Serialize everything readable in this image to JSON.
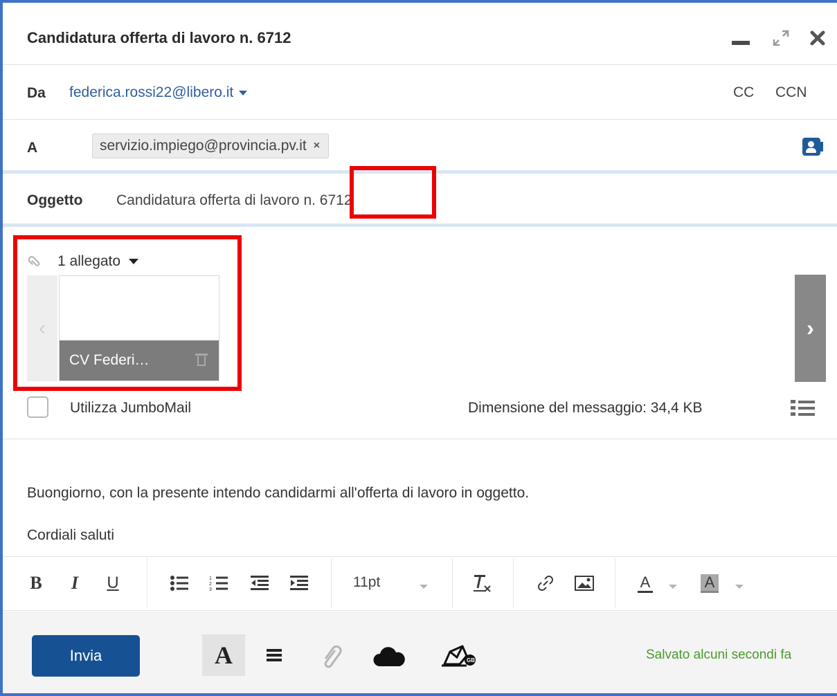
{
  "window": {
    "title": "Candidatura offerta di lavoro n. 6712"
  },
  "from": {
    "label": "Da",
    "value": "federica.rossi22@libero.it",
    "cc_label": "CC",
    "ccn_label": "CCN"
  },
  "to": {
    "label": "A",
    "recipients": [
      "servizio.impiego@provincia.pv.it"
    ],
    "remove_symbol": "×"
  },
  "subject": {
    "label": "Oggetto",
    "value": "Candidatura offerta di lavoro n. 6712"
  },
  "attachments": {
    "summary": "1 allegato",
    "files": [
      {
        "name": "CV Federi…"
      }
    ]
  },
  "options": {
    "jumbomail_label": "Utilizza JumboMail",
    "jumbomail_checked": false,
    "message_size": "Dimensione del messaggio: 34,4 KB"
  },
  "body": {
    "lines": [
      "Buongiorno, con la presente intendo candidarmi all'offerta di lavoro in oggetto.",
      "Cordiali saluti"
    ]
  },
  "format_toolbar": {
    "bold": "B",
    "italic": "I",
    "underline": "U",
    "font_size": "11pt",
    "text_color_label": "A",
    "bg_color_label": "A",
    "icons": [
      "bullet-list-icon",
      "numbered-list-icon",
      "outdent-icon",
      "indent-icon",
      "clear-format-icon",
      "link-icon",
      "image-icon"
    ]
  },
  "footer": {
    "send_label": "Invia",
    "text_format_label": "A",
    "save_status": "Salvato alcuni secondi fa"
  },
  "colors": {
    "accent_blue": "#165293",
    "link_blue": "#2f5f9e",
    "frame_blue": "#3f72c6",
    "highlight_red": "#ee0000",
    "saved_green": "#4a9a2c"
  }
}
